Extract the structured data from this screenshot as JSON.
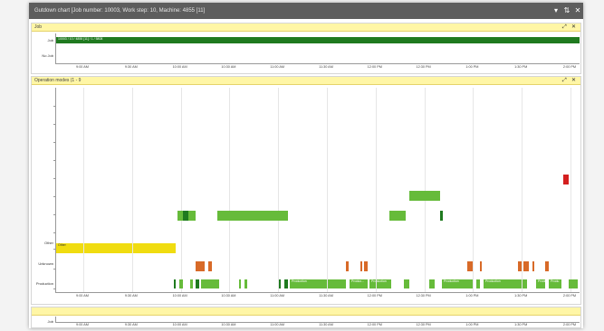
{
  "window": {
    "title": "Gutdown chart [Job number: 10003, Work step: 10, Machine: 4855 [11]",
    "buttons": [
      "▾",
      "⇅",
      "✕"
    ]
  },
  "colors": {
    "production_dark": "#1f7a1f",
    "production_light": "#66bb3a",
    "other": "#f0dc10",
    "unknown": "#d86a28",
    "alarm": "#d41f1f"
  },
  "panel1": {
    "title": "Job",
    "rows": [
      "Job",
      "No Job"
    ],
    "job_bar_label": "10003 / 10 / 4855 [11] / 1 / 5808",
    "x_ticks": [
      "9:00 AM",
      "9:30 AM",
      "10:00 AM",
      "10:30 AM",
      "11:00 AM",
      "11:30 AM",
      "12:00 PM",
      "12:30 PM",
      "1:00 PM",
      "1:30 PM",
      "2:00 PM"
    ]
  },
  "panel2": {
    "title": "Operation modes (1 - 9",
    "rows": [
      "Other",
      "Unknown",
      "Production"
    ],
    "other_bar_label": "Other",
    "production_labels": [
      "Production",
      "Produc...",
      "Production",
      "Production",
      "Production",
      "Production",
      "Produ"
    ],
    "x_ticks": [
      "9:00 AM",
      "9:30 AM",
      "10:00 AM",
      "10:30 AM",
      "11:00 AM",
      "11:30 AM",
      "12:00 PM",
      "12:30 PM",
      "1:00 PM",
      "1:30 PM",
      "2:00 PM"
    ]
  },
  "panel3": {
    "row": "Job",
    "x_ticks": [
      "9:00 AM",
      "9:30 AM",
      "10:00 AM",
      "10:30 AM",
      "11:00 AM",
      "11:30 AM",
      "12:00 PM",
      "12:30 PM",
      "1:00 PM",
      "1:30 PM",
      "2:00 PM"
    ]
  }
}
